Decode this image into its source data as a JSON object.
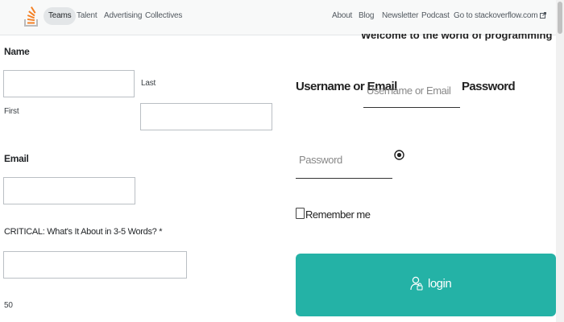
{
  "nav": {
    "items": [
      "Teams",
      "Talent",
      "Advertising",
      "Collectives",
      "About",
      "Blog",
      "Newsletter",
      "Podcast",
      "Go to stackoverflow.com"
    ],
    "logo_icon": "stackoverflow-logo-icon",
    "external_icon": "external-link-icon"
  },
  "form": {
    "name_label": "Name",
    "first_label": "First",
    "last_label": "Last",
    "first_value": "",
    "last_value": "",
    "email_label": "Email",
    "email_value": "",
    "critical_label": "CRITICAL: What's It About in 3-5 Words? *",
    "critical_value": "",
    "char_count": "50"
  },
  "login": {
    "welcome": "Welcome to the world of programming",
    "username_label": "Username or Email",
    "username_placeholder": "Username or Email",
    "password_label": "Password",
    "password_placeholder": "Password",
    "eye_icon": "eye-icon",
    "remember_label": "Remember me",
    "remember_checked": false,
    "button_label": "login",
    "button_icon": "user-icon"
  },
  "colors": {
    "button_bg": "#24b2a6",
    "logo_orange": "#f48024",
    "logo_gray": "#bcbbbb",
    "nav_bg": "#f8f9f9"
  }
}
